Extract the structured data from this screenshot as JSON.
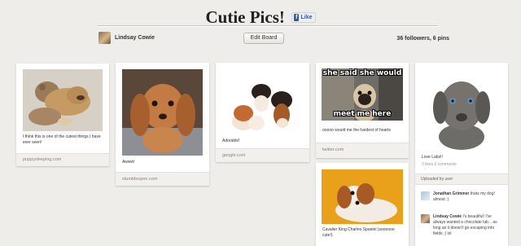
{
  "board": {
    "title": "Cutie Pics!",
    "fb_like": "Like",
    "owner": "Lindsay Cowie",
    "edit_button": "Edit Board",
    "stats": "36 followers, 6 pins"
  },
  "pins": [
    {
      "description": "I think this is one of the cutest things I have ever seen!",
      "source": "puppysleeping.com"
    },
    {
      "description": "Awww!",
      "source": "stumbleupon.com"
    },
    {
      "description": "Adorable!",
      "source": "google.com"
    },
    {
      "meme_top": "she said she would",
      "meme_bottom": "meet me here",
      "description": "ooooo would me the hardest of hearts",
      "source": "twitter.com"
    },
    {
      "description": "Cavalier King Charles Spaniel (soooooo cute!)"
    },
    {
      "description": "Love Labs!!",
      "stats": "2 likes  2 comments",
      "uploaded_by": "Uploaded by user",
      "comments": [
        {
          "author": "Jonathan Grimmer",
          "text": "thats my dog! almost :)"
        },
        {
          "author": "Lindsay Cowie",
          "text": "I's beautiful! I've always wanted a chocolate lab... as long as it doesn't go escaping into fields ;) lol"
        }
      ]
    }
  ],
  "colors": {
    "background": "#efedea",
    "source_text": "#8c7e7e",
    "fb_blue": "#3b5998"
  }
}
